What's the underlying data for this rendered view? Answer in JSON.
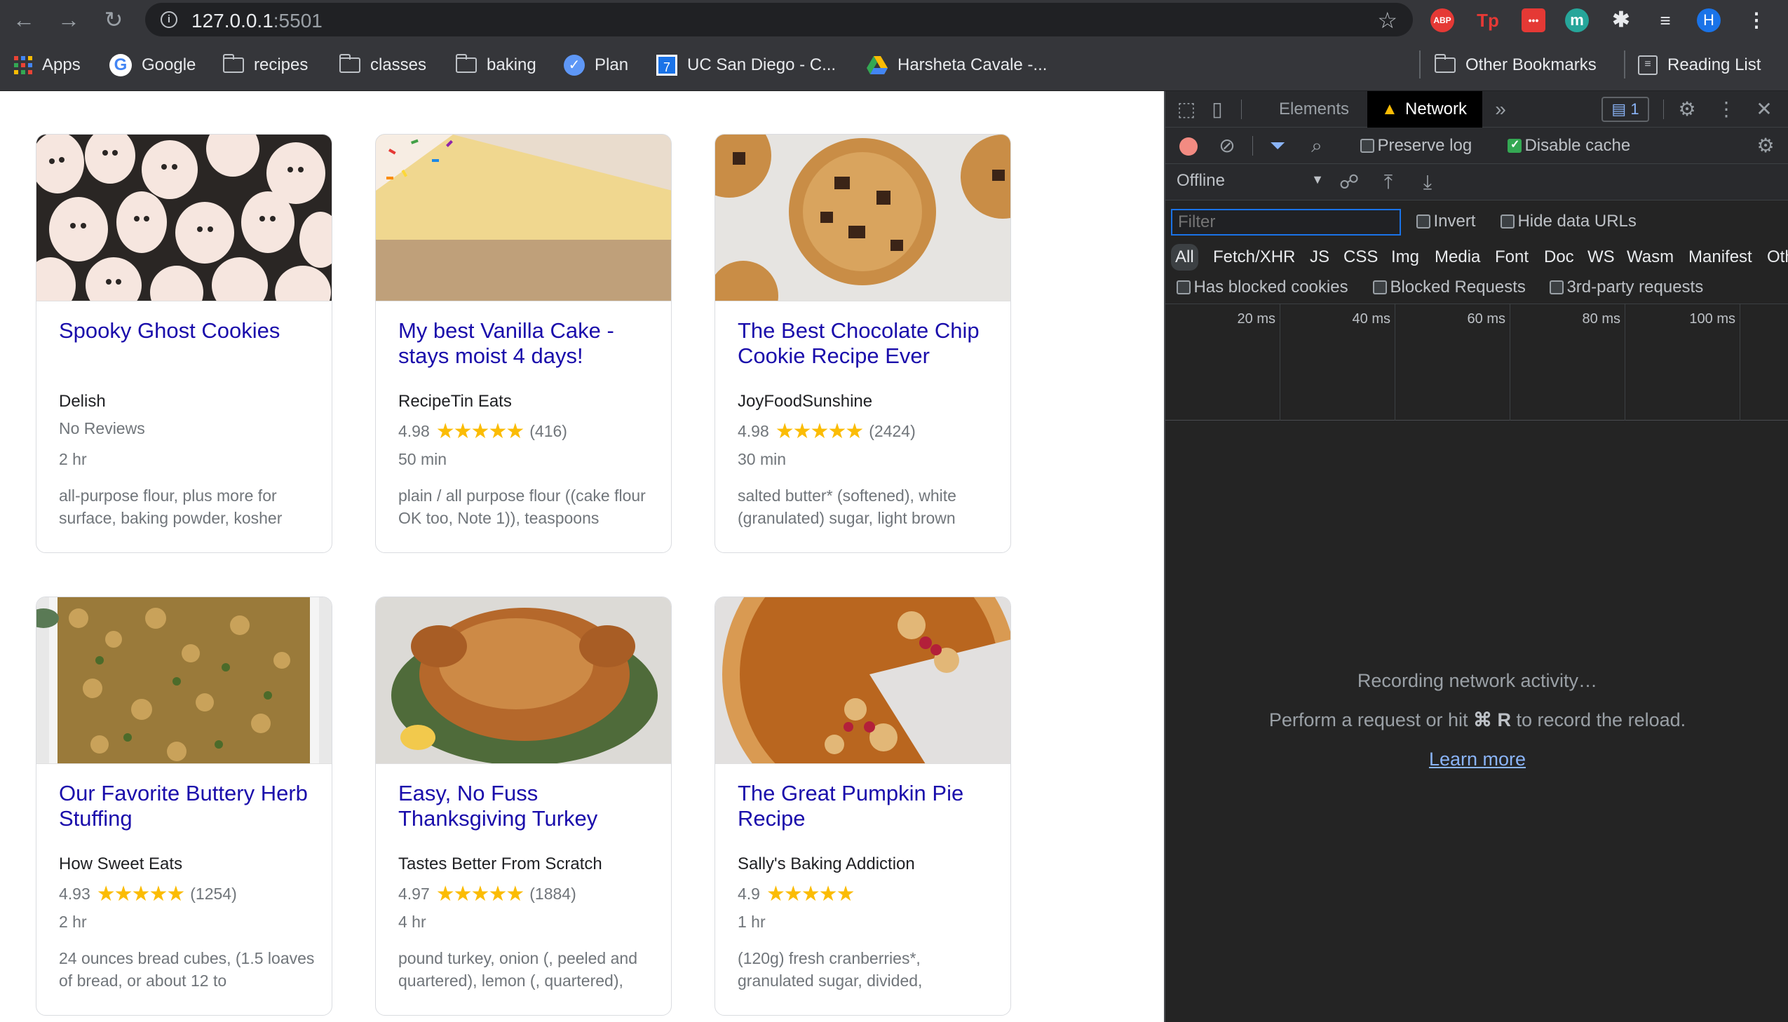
{
  "browser": {
    "url_host": "127.0.0.1",
    "url_port": ":5501",
    "extensions": [
      {
        "name": "abp-icon",
        "text": "ABP",
        "color": "#e53935"
      },
      {
        "name": "tp-icon",
        "text": "Tp",
        "color": "#e53935"
      },
      {
        "name": "dots-ext-icon",
        "text": "•••",
        "color": "#e53935"
      },
      {
        "name": "m-ext-icon",
        "text": "m",
        "color": "#26a69a"
      }
    ],
    "profile_initial": "H"
  },
  "bookmarks": {
    "apps": "Apps",
    "items": [
      "Google",
      "recipes",
      "classes",
      "baking",
      "Plan",
      "UC San Diego - C...",
      "Harsheta Cavale -..."
    ],
    "other": "Other Bookmarks",
    "reading_list": "Reading List"
  },
  "recipes": [
    {
      "title": "Spooky Ghost Cookies",
      "source": "Delish",
      "rating_text": "No Reviews",
      "rating": null,
      "reviews": "",
      "time": "2 hr",
      "ingredients": "all-purpose flour, plus more for surface, baking powder, kosher"
    },
    {
      "title": "My best Vanilla Cake - stays moist 4 days!",
      "source": "RecipeTin Eats",
      "rating_text": "4.98",
      "rating": 4.98,
      "reviews": "(416)",
      "time": "50 min",
      "ingredients": "plain / all purpose flour ((cake flour OK too, Note 1)), teaspoons"
    },
    {
      "title": "The Best Chocolate Chip Cookie Recipe Ever",
      "source": "JoyFoodSunshine",
      "rating_text": "4.98",
      "rating": 4.98,
      "reviews": "(2424)",
      "time": "30 min",
      "ingredients": "salted butter* (softened), white (granulated) sugar, light brown"
    },
    {
      "title": "Our Favorite Buttery Herb Stuffing",
      "source": "How Sweet Eats",
      "rating_text": "4.93",
      "rating": 4.93,
      "reviews": "(1254)",
      "time": "2 hr",
      "ingredients": "24 ounces bread cubes, (1.5 loaves of bread, or about 12 to"
    },
    {
      "title": "Easy, No Fuss Thanksgiving Turkey",
      "source": "Tastes Better From Scratch",
      "rating_text": "4.97",
      "rating": 4.97,
      "reviews": "(1884)",
      "time": "4 hr",
      "ingredients": "pound turkey, onion (, peeled and quartered), lemon (, quartered),"
    },
    {
      "title": "The Great Pumpkin Pie Recipe",
      "source": "Sally's Baking Addiction",
      "rating_text": "4.9",
      "rating": 4.9,
      "reviews": "",
      "time": "1 hr",
      "ingredients": "(120g) fresh cranberries*, granulated sugar, divided,"
    }
  ],
  "devtools": {
    "tabs": {
      "elements": "Elements",
      "network": "Network"
    },
    "issues_count": "1",
    "preserve_log": "Preserve log",
    "disable_cache": "Disable cache",
    "throttle": "Offline",
    "filter_placeholder": "Filter",
    "invert": "Invert",
    "hide_data_urls": "Hide data URLs",
    "types": [
      "All",
      "Fetch/XHR",
      "JS",
      "CSS",
      "Img",
      "Media",
      "Font",
      "Doc",
      "WS",
      "Wasm",
      "Manifest",
      "Oth"
    ],
    "has_blocked_cookies": "Has blocked cookies",
    "blocked_requests": "Blocked Requests",
    "third_party": "3rd-party requests",
    "timeline_ticks": [
      "20 ms",
      "40 ms",
      "60 ms",
      "80 ms",
      "100 ms"
    ],
    "recording": "Recording network activity…",
    "perform_prefix": "Perform a request or hit ",
    "perform_keys": "⌘ R",
    "perform_suffix": " to record the reload.",
    "learn_more": "Learn more"
  }
}
